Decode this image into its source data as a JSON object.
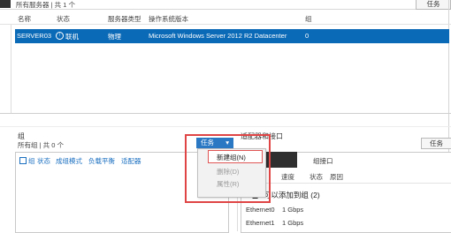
{
  "top": {
    "title": "所有服务器 | 共 1 个",
    "task_button": "任务"
  },
  "server_table": {
    "columns": [
      "名称",
      "状态",
      "服务器类型",
      "操作系统版本",
      "组"
    ],
    "selected_row": {
      "name": "SERVER03",
      "status": "联机",
      "type": "物理",
      "os": "Microsoft Windows Server 2012 R2 Datacenter",
      "group": "0"
    }
  },
  "groups_panel": {
    "title": "组",
    "subtitle": "所有组 | 共 0 个",
    "columns": [
      "组",
      "状态",
      "成组模式",
      "负载平衡",
      "适配器"
    ]
  },
  "adapter_panel": {
    "title": "适配器和接口",
    "task_button": "任务",
    "tab_active": "",
    "tab_team": "组接口",
    "columns": [
      "速度",
      "状态",
      "原因"
    ],
    "group_header": "可以添加到组 (2)",
    "adapters": [
      {
        "name": "Ethernet0",
        "speed": "1 Gbps"
      },
      {
        "name": "Ethernet1",
        "speed": "1 Gbps"
      }
    ]
  },
  "task_menu": {
    "button": "任务",
    "items": [
      "新建组(N)",
      "删除(D)",
      "属性(R)"
    ]
  },
  "colors": {
    "accent": "#0b6ab7",
    "button_blue": "#2a78c4",
    "highlight_red": "#e04545"
  }
}
